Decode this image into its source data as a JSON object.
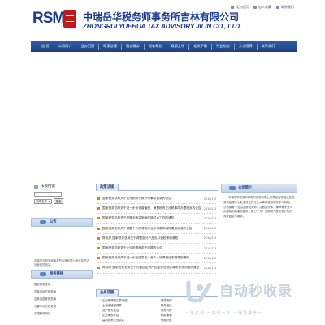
{
  "header": {
    "logo_text": "RSM",
    "company_cn": "中瑞岳华税务师事务所吉林有限公司",
    "company_en": "ZHONGRUI YUEHUA TAX ADVISORY JILIN CO., LTD.",
    "quicklinks": [
      {
        "label": "设为首页",
        "icon": "home-icon"
      },
      {
        "label": "加入收藏",
        "icon": "star-icon"
      },
      {
        "label": "联系我们",
        "icon": "mail-icon"
      }
    ]
  },
  "nav": [
    "首 页",
    "公司简介",
    "业务范围",
    "政策法规",
    "税务服务",
    "税收筹划",
    "政策文件",
    "相关下载",
    "行业动态",
    "人才招聘",
    "联系我们"
  ],
  "search": {
    "title": "法规搜索",
    "select_value": "法规名称",
    "button": "搜索"
  },
  "notice": {
    "title": "公告",
    "body": "中瑞岳华税务师事务所吉林有限公司欢迎您访问我们的网站。"
  },
  "links": {
    "title": "税务链接",
    "items": [
      "国家税务总局",
      "吉林省地方税务局",
      "吉林省国家税务局",
      "长春市地方税务局",
      "中国税务网站"
    ]
  },
  "policy": {
    "title": "政策法规",
    "rows": [
      {
        "title": "国家税务总局关于发布税务行政许可事项目录的公告",
        "date": "2018/1/3"
      },
      {
        "title": "国家税务总局关于进一步优化增值税、消费税有关涉税事项办理程序的公告",
        "date": "2018/1/3"
      },
      {
        "title": "国家税务总局关于开展全面实施营改增试点工作的通知",
        "date": "2018/1/3"
      },
      {
        "title": "国家税务总局关于调整个人所得税综合所得基本减除费用标准的公告",
        "date": "2018/1/3"
      },
      {
        "title": "财政部 国家税务总局关于调整部分产品出口退税率的通知",
        "date": "2018/1/3"
      },
      {
        "title": "国家税务总局关于企业所得税若干问题的公告",
        "date": "2018/1/3"
      },
      {
        "title": "国家税务总局关于进一步加强高收入者个人所得税征收管理的通知",
        "date": "2018/1/3"
      },
      {
        "title": "财政部 国家税务总局关于完善固定资产加速折旧税收政策有关问题的通知",
        "date": "2018/1/3"
      }
    ]
  },
  "services": {
    "title": "业务范围",
    "items": [
      "企业所得税汇算清缴",
      "税务咨询",
      "土地增值税清算",
      "税务鉴证",
      "资产损失鉴证",
      "税务代理",
      "企业纳税评估",
      "税收筹划",
      "高新技术企业认定",
      "代理记账"
    ]
  },
  "company": {
    "title": "公司简介",
    "body": "中瑞岳华税务师事务所吉林有限公司是经吉林省注册税务师管理中心批准设立的专业从事涉税服务的中介机构。公司拥有一支由注册税务师、注册会计师、律师等专业人员组成的高素质团队，致力于为广大纳税人提供全方位的涉税鉴证与服务。"
  }
}
